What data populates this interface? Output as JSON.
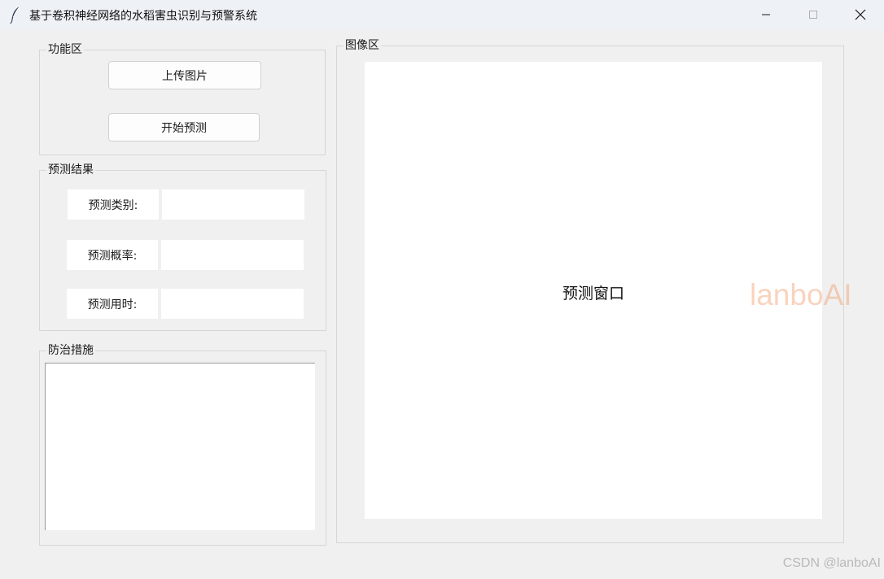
{
  "window": {
    "title": "基于卷积神经网络的水稻害虫识别与预警系统",
    "icon": "feather-icon",
    "controls": [
      "minimize-icon",
      "maximize-icon",
      "close-icon"
    ]
  },
  "function_area": {
    "label": "功能区",
    "upload_button": "上传图片",
    "predict_button": "开始预测"
  },
  "result_area": {
    "label": "预测结果",
    "category_label": "预测类别:",
    "category_value": "",
    "probability_label": "预测概率:",
    "probability_value": "",
    "time_label": "预测用时:",
    "time_value": ""
  },
  "measures_area": {
    "label": "防治措施",
    "text": ""
  },
  "image_area": {
    "label": "图像区",
    "placeholder": "预测窗口"
  },
  "watermarks": {
    "overlay": "lanboAI",
    "footer": "CSDN @lanboAI"
  }
}
